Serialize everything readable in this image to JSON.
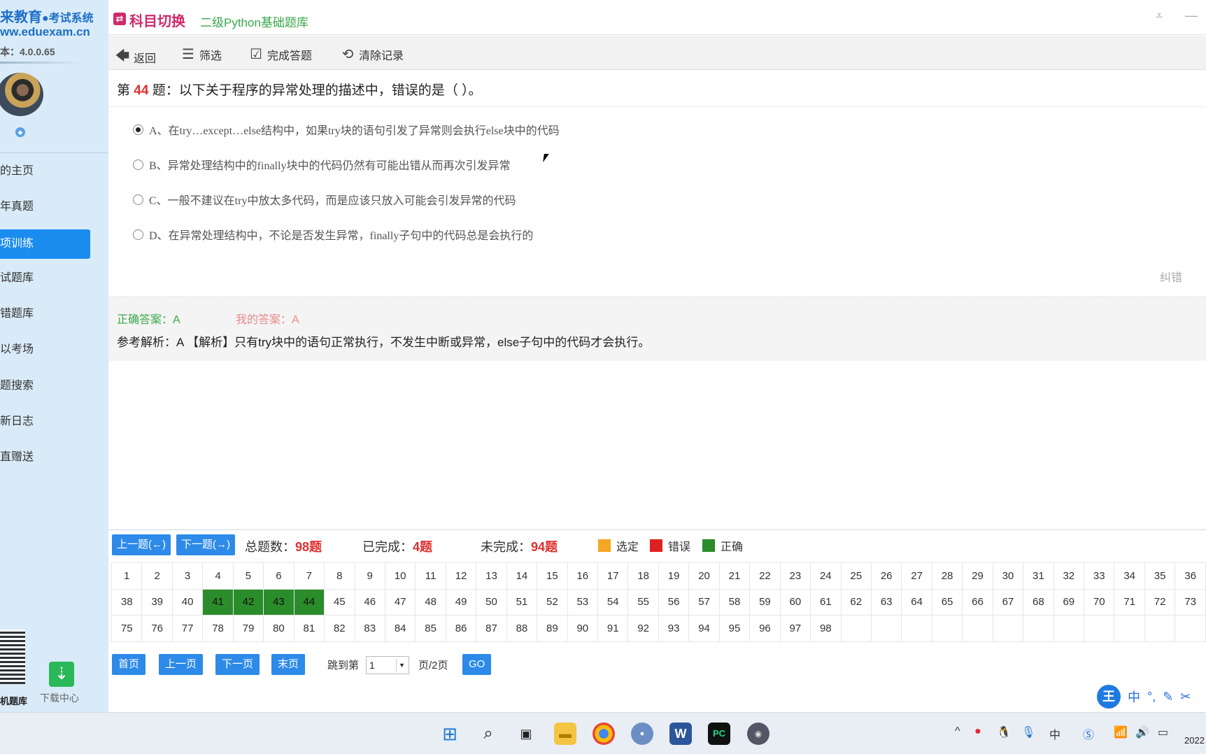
{
  "sidebar": {
    "brand": "来教育",
    "brand_suffix": "●考试系统",
    "url": "ww.eduexam.cn",
    "version": "本：4.0.0.65",
    "items": [
      {
        "label": "的主页"
      },
      {
        "label": "年真题"
      },
      {
        "label": "项训练",
        "active": true
      },
      {
        "label": "试题库"
      },
      {
        "label": "错题库"
      },
      {
        "label": "以考场"
      },
      {
        "label": "题搜索"
      },
      {
        "label": "新日志"
      },
      {
        "label": "直赠送"
      }
    ],
    "qr_label": "机题库",
    "download_label": "下载中心"
  },
  "header": {
    "title": "科目切换",
    "subtitle": "二级Python基础题库"
  },
  "toolbar": {
    "back": "返回",
    "filter": "筛选",
    "finish": "完成答题",
    "clear": "清除记录"
  },
  "question": {
    "prefix": "第",
    "number": "44",
    "suffix": "题：以下关于程序的异常处理的描述中，错误的是（ ）。",
    "options": [
      {
        "text": "A、在try…except…else结构中，如果try块的语句引发了异常则会执行else块中的代码",
        "checked": true
      },
      {
        "text": "B、异常处理结构中的finally块中的代码仍然有可能出错从而再次引发异常",
        "checked": false
      },
      {
        "text": "C、一般不建议在try中放太多代码，而是应该只放入可能会引发异常的代码",
        "checked": false
      },
      {
        "text": "D、在异常处理结构中，不论是否发生异常，finally子句中的代码总是会执行的",
        "checked": false
      }
    ],
    "correction_link": "纠错"
  },
  "answer": {
    "correct": "正确答案：A",
    "mine": "我的答案：A",
    "explanation": "参考解析：A 【解析】只有try块中的语句正常执行，不发生中断或异常，else子句中的代码才会执行。"
  },
  "navigation": {
    "prev": "上一题(←)",
    "next": "下一题(→)",
    "total_label": "总题数：",
    "total_value": "98题",
    "done_label": "已完成：",
    "done_value": "4题",
    "todo_label": "未完成：",
    "todo_value": "94题",
    "legend": [
      {
        "label": "选定",
        "color": "#f5a623"
      },
      {
        "label": "错误",
        "color": "#e02020"
      },
      {
        "label": "正确",
        "color": "#2a8c2a"
      }
    ]
  },
  "grid": {
    "rows": [
      [
        "1",
        "2",
        "3",
        "4",
        "5",
        "6",
        "7",
        "8",
        "9",
        "10",
        "11",
        "12",
        "13",
        "14",
        "15",
        "16",
        "17",
        "18",
        "19",
        "20",
        "21",
        "22",
        "23",
        "24",
        "25",
        "26",
        "27",
        "28",
        "29",
        "30",
        "31",
        "32",
        "33",
        "34",
        "35",
        "36"
      ],
      [
        "38",
        "39",
        "40",
        "41",
        "42",
        "43",
        "44",
        "45",
        "46",
        "47",
        "48",
        "49",
        "50",
        "51",
        "52",
        "53",
        "54",
        "55",
        "56",
        "57",
        "58",
        "59",
        "60",
        "61",
        "62",
        "63",
        "64",
        "65",
        "66",
        "67",
        "68",
        "69",
        "70",
        "71",
        "72",
        "73"
      ],
      [
        "75",
        "76",
        "77",
        "78",
        "79",
        "80",
        "81",
        "82",
        "83",
        "84",
        "85",
        "86",
        "87",
        "88",
        "89",
        "90",
        "91",
        "92",
        "93",
        "94",
        "95",
        "96",
        "97",
        "98",
        "",
        "",
        "",
        "",
        "",
        "",
        "",
        "",
        "",
        "",
        "",
        ""
      ]
    ],
    "done": [
      "41",
      "42",
      "43",
      "44"
    ]
  },
  "pagination": {
    "first": "首页",
    "prev": "上一页",
    "next": "下一页",
    "last": "末页",
    "jump_label": "跳到第",
    "page_value": "1",
    "page_suffix": "页/2页",
    "go": "GO"
  },
  "ime": {
    "logo": "王",
    "mode": "中"
  },
  "taskbar": {
    "tray_lang": "中",
    "clock": "2022"
  }
}
